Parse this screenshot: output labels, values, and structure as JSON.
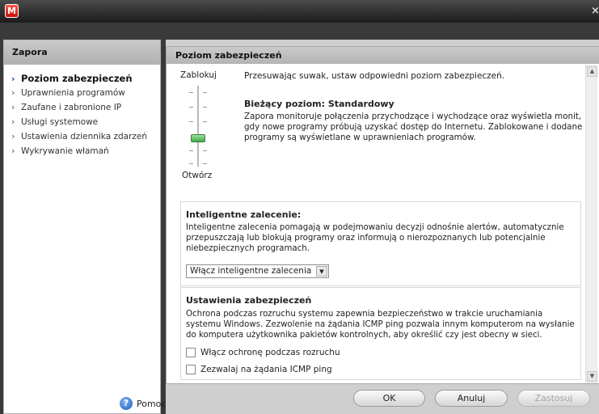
{
  "window": {
    "logo_letter": "M",
    "close_glyph": "×",
    "brand_color": "#d8261c"
  },
  "sidebar": {
    "title": "Zapora",
    "items": [
      {
        "label": "Poziom zabezpieczeń",
        "active": true
      },
      {
        "label": "Uprawnienia programów",
        "active": false
      },
      {
        "label": "Zaufane i zabronione IP",
        "active": false
      },
      {
        "label": "Usługi systemowe",
        "active": false
      },
      {
        "label": "Ustawienia dziennika zdarzeń",
        "active": false
      },
      {
        "label": "Wykrywanie włamań",
        "active": false
      }
    ],
    "chevron": "›",
    "help_label": "Pomoc",
    "help_icon": "?"
  },
  "main": {
    "title": "Poziom zabezpieczeń",
    "slider": {
      "top_label": "Zablokuj",
      "bottom_label": "Otwórz",
      "level_fraction": 0.67
    },
    "instruction": "Przesuwając suwak, ustaw odpowiedni poziom zabezpieczeń.",
    "current_level_title": "Bieżący poziom:  Standardowy",
    "current_level_desc": "Zapora monitoruje połączenia przychodzące i wychodzące oraz wyświetla monit, gdy nowe programy próbują uzyskać dostęp do Internetu. Zablokowane i dodane programy są wyświetlane w uprawnieniach programów.",
    "smart": {
      "title": "Inteligentne zalecenie:",
      "desc": "Inteligentne zalecenia pomagają w podejmowaniu decyzji odnośnie alertów, automatycznie przepuszczają lub blokują programy oraz informują o nierozpoznanych lub potencjalnie niebezpiecznych programach.",
      "select_value": "Włącz inteligentne zalecenia"
    },
    "security": {
      "title": "Ustawienia zabezpieczeń",
      "desc": "Ochrona podczas rozruchu systemu zapewnia bezpieczeństwo w trakcie uruchamiania systemu Windows. Zezwolenie na żądania ICMP ping pozwala innym komputerom na wysłanie do komputera użytkownika pakietów kontrolnych, aby określić czy jest obecny w sieci.",
      "checkbox_boot": "Włącz ochronę podczas rozruchu",
      "checkbox_icmp": "Zezwalaj na żądania ICMP ping"
    }
  },
  "buttons": {
    "ok": "OK",
    "cancel": "Anuluj",
    "apply": "Zastosuj"
  }
}
